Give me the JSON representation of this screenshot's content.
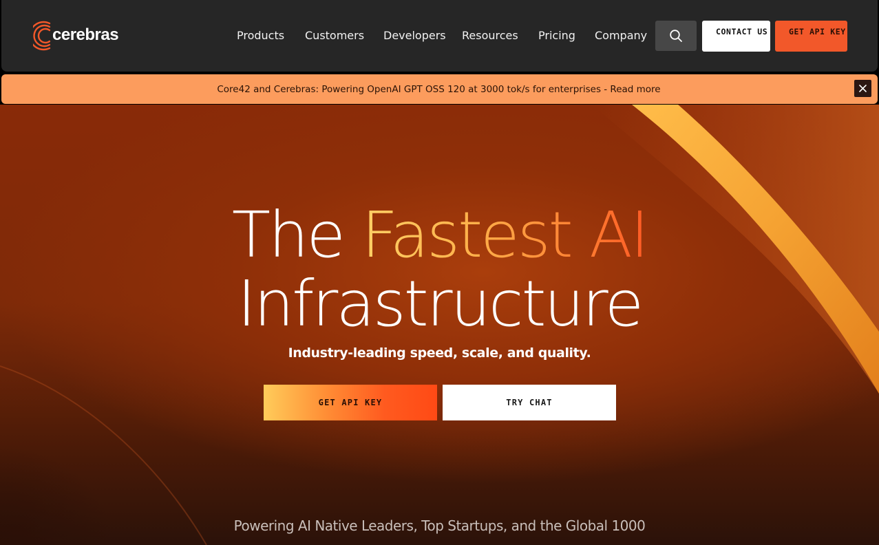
{
  "nav": {
    "brand": "cerebras",
    "links": [
      "Products",
      "Customers",
      "Developers",
      "Resources",
      "Pricing",
      "Company"
    ],
    "contact_label": "CONTACT US",
    "api_key_label": "GET API KEY",
    "search_icon": "search-icon"
  },
  "banner": {
    "text": "Core42 and Cerebras: Powering OpenAI GPT OSS 120 at 3000 tok/s for enterprises - Read more",
    "close_icon": "close-icon"
  },
  "hero": {
    "title_word1": "The",
    "title_accent": "Fastest AI",
    "title_line2": "Infrastructure",
    "subtitle": "Industry-leading speed, scale, and quality.",
    "primary_cta": "GET API KEY",
    "secondary_cta": "TRY CHAT",
    "tagline": "Powering AI Native Leaders, Top Startups, and the Global 1000"
  },
  "colors": {
    "nav_bg": "#262626",
    "brand_orange": "#f2582a",
    "banner_bg": "#fc9c5d",
    "hero_bg": "#892a08"
  }
}
